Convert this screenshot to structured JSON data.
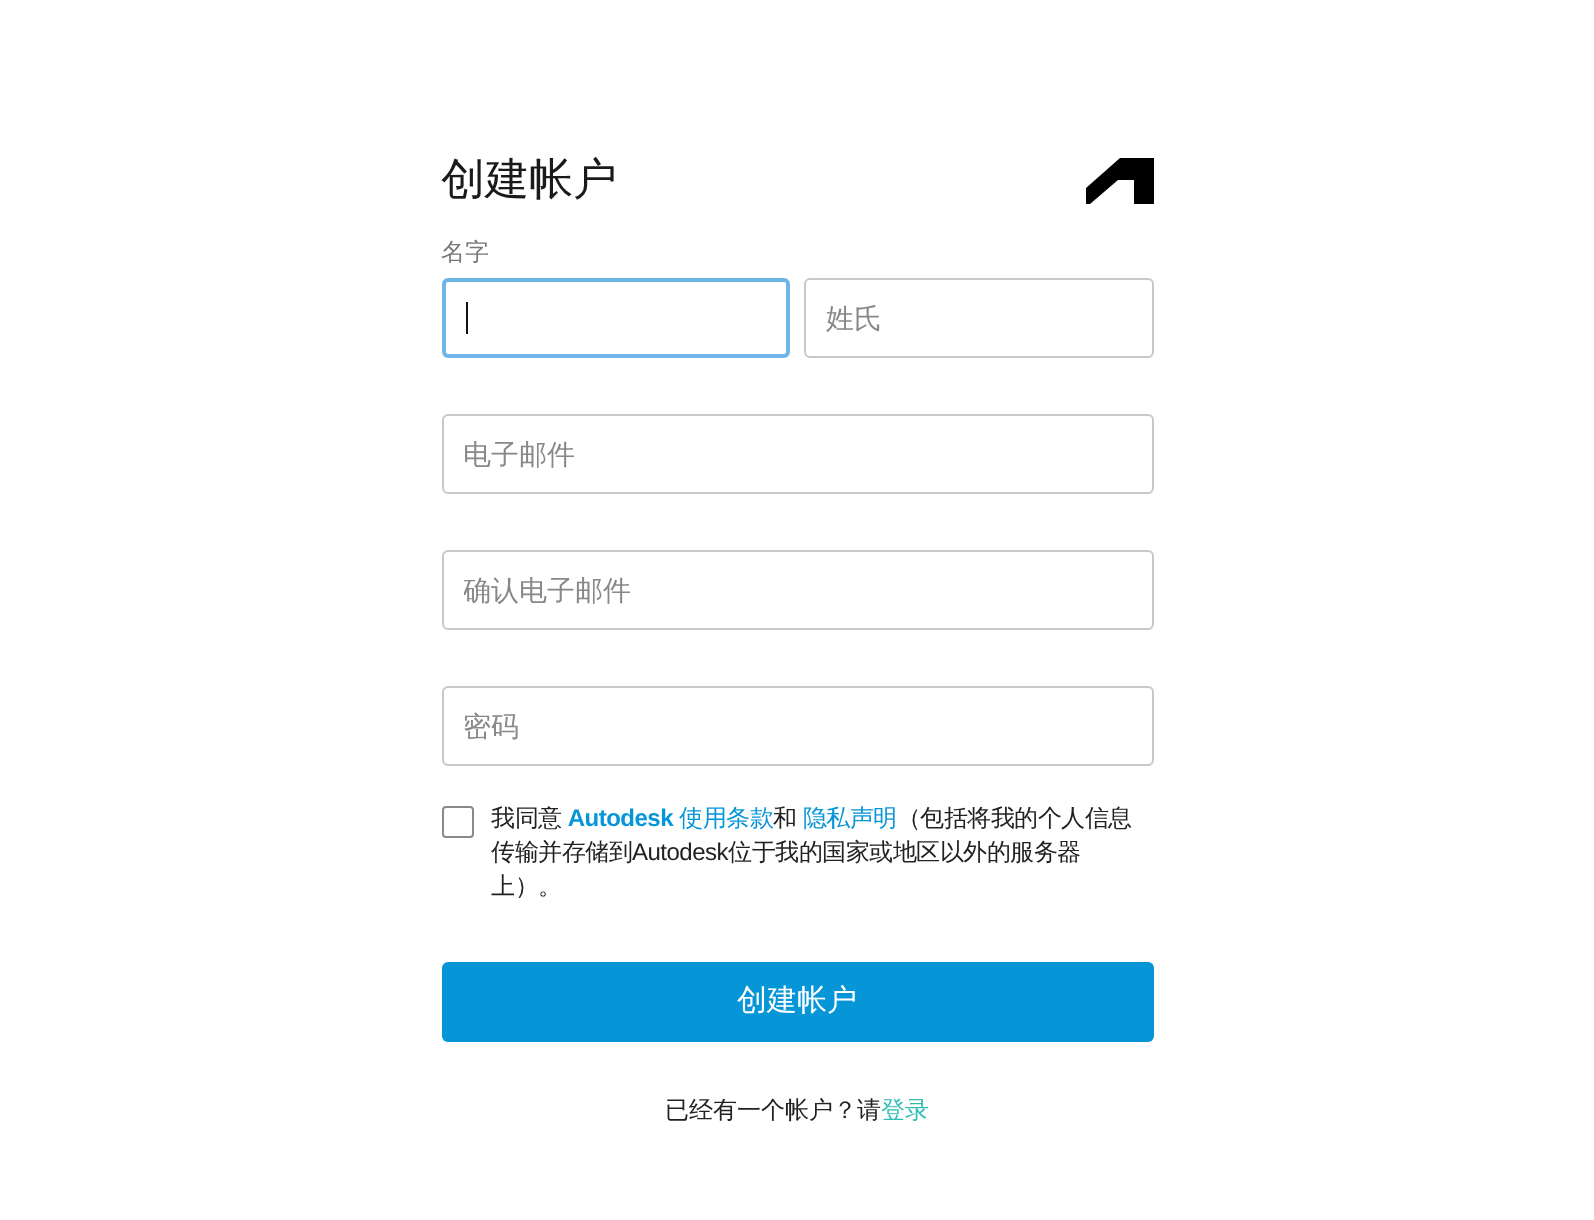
{
  "title": "创建帐户",
  "name_label": "名字",
  "first_name": {
    "focused": true
  },
  "last_name": {
    "placeholder": "姓氏",
    "focused": false
  },
  "email": {
    "placeholder": "电子邮件",
    "focused": false
  },
  "confirm_email": {
    "placeholder": "确认电子邮件",
    "focused": false
  },
  "password": {
    "placeholder": "密码",
    "focused": false
  },
  "agreement": {
    "checked": false,
    "parts": [
      {
        "kind": "text",
        "text": "我同意 "
      },
      {
        "kind": "link",
        "text": "**Autodesk** 使用条款"
      },
      {
        "kind": "text",
        "text": "和 "
      },
      {
        "kind": "link",
        "text": "隐私声明"
      },
      {
        "kind": "text",
        "text": "（包括将我的个人信息传输并存储到Autodesk位于我的国家或地区以外的服务器上）。"
      }
    ]
  },
  "submit_button": "创建帐户",
  "footer": {
    "text": "已经有一个帐户？请",
    "link": "登录"
  }
}
